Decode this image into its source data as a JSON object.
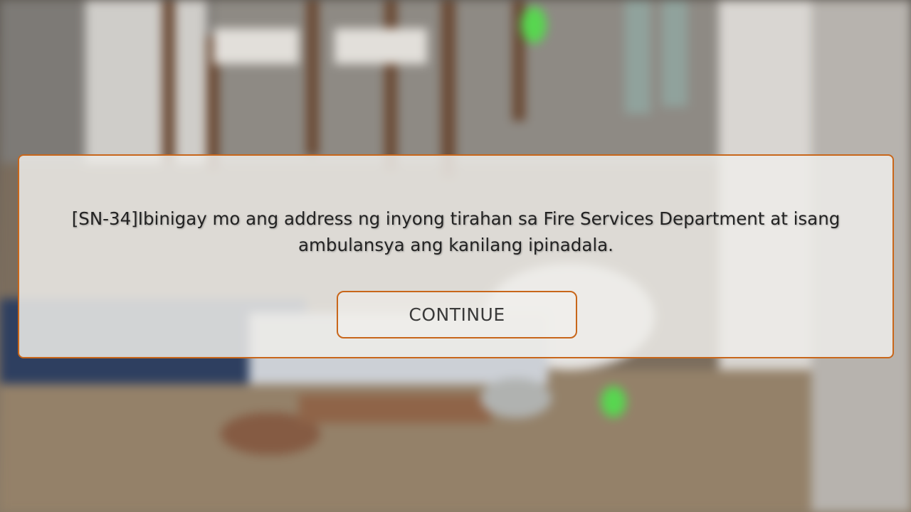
{
  "dialog": {
    "message": "[SN-34]Ibinigay mo ang address ng inyong tirahan sa Fire Services Department at isang ambulansya ang kanilang ipinadala.",
    "continue_label": "CONTINUE"
  },
  "colors": {
    "accent_border": "#c8661a",
    "panel_background": "#eeece9",
    "text": "#232323"
  }
}
